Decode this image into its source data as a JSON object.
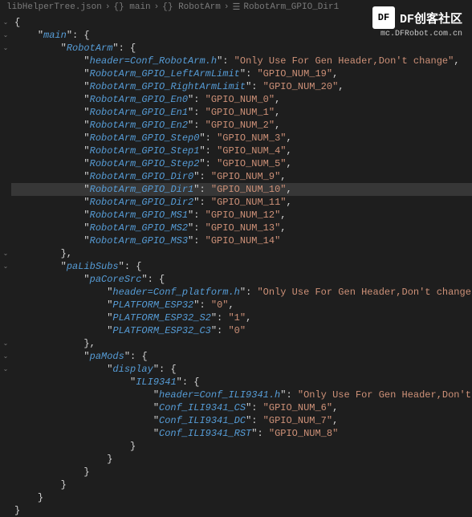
{
  "breadcrumb": {
    "file": "libHelperTree.json",
    "sep": "›",
    "p1": "{} main",
    "p2": "{} RobotArm",
    "p3": "RobotArm_GPIO_Dir1"
  },
  "watermark": {
    "brand": "DF创客社区",
    "url": "mc.DFRobot.com.cn",
    "logo": "DF"
  },
  "code": {
    "main_key": "main",
    "robotarm_key": "RobotArm",
    "ra": {
      "header_k": "header=Conf_RobotArm.h",
      "header_v": "Only Use For Gen Header,Don't change",
      "left_k": "RobotArm_GPIO_LeftArmLimit",
      "left_v": "GPIO_NUM_19",
      "right_k": "RobotArm_GPIO_RightArmLimit",
      "right_v": "GPIO_NUM_20",
      "en0_k": "RobotArm_GPIO_En0",
      "en0_v": "GPIO_NUM_0",
      "en1_k": "RobotArm_GPIO_En1",
      "en1_v": "GPIO_NUM_1",
      "en2_k": "RobotArm_GPIO_En2",
      "en2_v": "GPIO_NUM_2",
      "step0_k": "RobotArm_GPIO_Step0",
      "step0_v": "GPIO_NUM_3",
      "step1_k": "RobotArm_GPIO_Step1",
      "step1_v": "GPIO_NUM_4",
      "step2_k": "RobotArm_GPIO_Step2",
      "step2_v": "GPIO_NUM_5",
      "dir0_k": "RobotArm_GPIO_Dir0",
      "dir0_v": "GPIO_NUM_9",
      "dir1_k": "RobotArm_GPIO_Dir1",
      "dir1_v": "GPIO_NUM_10",
      "dir2_k": "RobotArm_GPIO_Dir2",
      "dir2_v": "GPIO_NUM_11",
      "ms1_k": "RobotArm_GPIO_MS1",
      "ms1_v": "GPIO_NUM_12",
      "ms2_k": "RobotArm_GPIO_MS2",
      "ms2_v": "GPIO_NUM_13",
      "ms3_k": "RobotArm_GPIO_MS3",
      "ms3_v": "GPIO_NUM_14"
    },
    "palibsubs_key": "paLibSubs",
    "pacoresrc_key": "paCoreSrc",
    "pc": {
      "header_k": "header=Conf_platform.h",
      "header_v": "Only Use For Gen Header,Don't change",
      "esp32_k": "PLATFORM_ESP32",
      "esp32_v": "0",
      "esp32s2_k": "PLATFORM_ESP32_S2",
      "esp32s2_v": "1",
      "esp32c3_k": "PLATFORM_ESP32_C3",
      "esp32c3_v": "0"
    },
    "pamods_key": "paMods",
    "display_key": "display",
    "ili_key": "ILI9341",
    "ili": {
      "header_k": "header=Conf_ILI9341.h",
      "header_v": "Only Use For Gen Header,Don't change",
      "cs_k": "Conf_ILI9341_CS",
      "cs_v": "GPIO_NUM_6",
      "dc_k": "Conf_ILI9341_DC",
      "dc_v": "GPIO_NUM_7",
      "rst_k": "Conf_ILI9341_RST",
      "rst_v": "GPIO_NUM_8"
    }
  }
}
